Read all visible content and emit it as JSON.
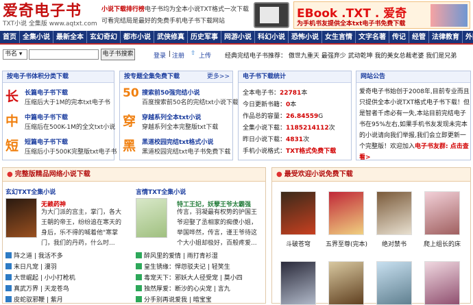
{
  "header": {
    "logo_text": "爱奇电子书",
    "logo_sub_left": "TXT小说",
    "logo_sub_mid": "全集版",
    "logo_url": "www.aqtxt.com",
    "slogan_highlight": "小说下载排行榜",
    "slogan_rest": "电子书均为全本小说TXT格式一次下载可看完结局是最好的免费手机电子书下载网站",
    "banner_title": "EBook .TXT . 爱奇",
    "banner_sub": "为手机书友提供全本txt电子书免费下载"
  },
  "nav": [
    "首页",
    "全集小说",
    "最新全本",
    "玄幻奇幻",
    "都市小说",
    "武侠修真",
    "历史军事",
    "网游小说",
    "科幻小说",
    "恐怖小说",
    "女生言情",
    "文字名著",
    "传记",
    "经管",
    "法律教育",
    "外国名著"
  ],
  "search": {
    "select_value": "书名",
    "button": "电子书搜索",
    "login": "登录",
    "sep": "|",
    "register": "注册",
    "upload": "上传",
    "recommend": "经典完结电子书推荐：  傲世九重天   最强弃少   武动乾坤   我的美女总裁老婆   我们是兄弟"
  },
  "size_panel": {
    "title": "按电子书体积分类下载",
    "items": [
      {
        "char": "长",
        "title": "长篇电子书下载",
        "desc": "压缩后大于1M的完本txt电子书",
        "color": "#d41010"
      },
      {
        "char": "中",
        "title": "中篇电子书下载",
        "desc": "压缩后在500K-1M的全文txt小说",
        "color": "#f08010"
      },
      {
        "char": "短",
        "title": "短篇电子书下载",
        "desc": "压缩后小于500K完整版txt电子书",
        "color": "#f08010"
      }
    ]
  },
  "topic_panel": {
    "title": "按专题全集免费下载",
    "more": "更多>>",
    "items": [
      {
        "char": "50",
        "title": "搜索前50强完结小说",
        "desc": "百度搜索前50名的完结txt小说下载",
        "color": "#f08010"
      },
      {
        "char": "穿",
        "title": "穿越系列全本txt小说",
        "desc": "穿越系列全本完整版txt下载",
        "color": "#f08010"
      },
      {
        "char": "黑",
        "title": "黑道校园完结txt格式小说",
        "desc": "黑道校园完结txt电子书免费下载",
        "color": "#f08010"
      }
    ]
  },
  "stats_panel": {
    "title": "电子书下载统计",
    "rows": [
      {
        "label": "全本电子书：",
        "value": "22781",
        "unit": "本"
      },
      {
        "label": "今日更新书籍：",
        "value": "0",
        "unit": "本"
      },
      {
        "label": "作品总的容量：",
        "value": "26.84559",
        "unit": "G"
      },
      {
        "label": "全集小说下载：",
        "value": "1185214112",
        "unit": "次"
      },
      {
        "label": "昨日小说下载：",
        "value": "4831",
        "unit": "次"
      },
      {
        "label": "手机小说格式：",
        "value": "TXT格式免费下载",
        "unit": ""
      }
    ]
  },
  "notice_panel": {
    "title": "网站公告",
    "text": "爱奇电子书始创于2008年,目前专业而且只提供全本小说TXT格式电子书下载！但是智者千虑必有一失,本站目前完结电子书在95%左右,如果手机书友发现未完本的小说请向我们举报,我们会立即更新一个完整版！欢迎加入",
    "highlight": "电子书友群: 点击查看>"
  },
  "featured": {
    "title": "完整版精品网络小说下载",
    "col1": {
      "header": "玄幻TXT全集小说",
      "book_title": "无赖药神",
      "book_desc": "为大门派的宫主，掌门，各大王朝的帝王，纷纷追在寒天的身后，乐不得的喊着他\"寒掌门，我们的丹药，什么时...",
      "list": [
        "阵之道 | 我活不多",
        "末日凡宠 | 漫羽",
        "大世崛起 | 小小打枪机",
        "真武万界 | 天龙苍鸟",
        "皮蛇驭邪鞭 | 紫月"
      ]
    },
    "col2": {
      "header": "言情TXT全集小说",
      "book_title": "特工王妃，妖孽王爷太霸强",
      "book_desc": "传言，羽凝最有权势的护国王爷迎娶了丞相家的痴傻小姐，举国哗然，传言，谨王爷待这个大小姐却极好，百般疼爱...",
      "list": [
        "醉风里的爱情 | 雨打青衫湿",
        "皇生锈缘：悍怨驳夫记 | 轻笑生",
        "毒宠天下：邪妖大人径受宠 | 莫小四",
        "独然厚爱：断沙的心尖宠 | 言九",
        "分手别再说爱我 | 暗宝宝"
      ]
    }
  },
  "popular": {
    "title": "最受欢迎小说免费下载",
    "books": [
      {
        "title": "斗破苍穹",
        "c1": "#3a2a1a",
        "c2": "#c84020"
      },
      {
        "title": "五界至尊(完本)",
        "c1": "#c02838",
        "c2": "#f0d080"
      },
      {
        "title": "绝对禁书",
        "c1": "#7a5a3a",
        "c2": "#e8e0d0"
      },
      {
        "title": "爬上组长的床",
        "c1": "#f2d0d8",
        "c2": "#a06060"
      },
      {
        "title": "",
        "c1": "#2a2a3a",
        "c2": "#b0b8c8"
      },
      {
        "title": "",
        "c1": "#d8c8a0",
        "c2": "#604020"
      },
      {
        "title": "",
        "c1": "#c8e0f0",
        "c2": "#608090"
      },
      {
        "title": "",
        "c1": "#f0d8e0",
        "c2": "#905070"
      }
    ]
  }
}
